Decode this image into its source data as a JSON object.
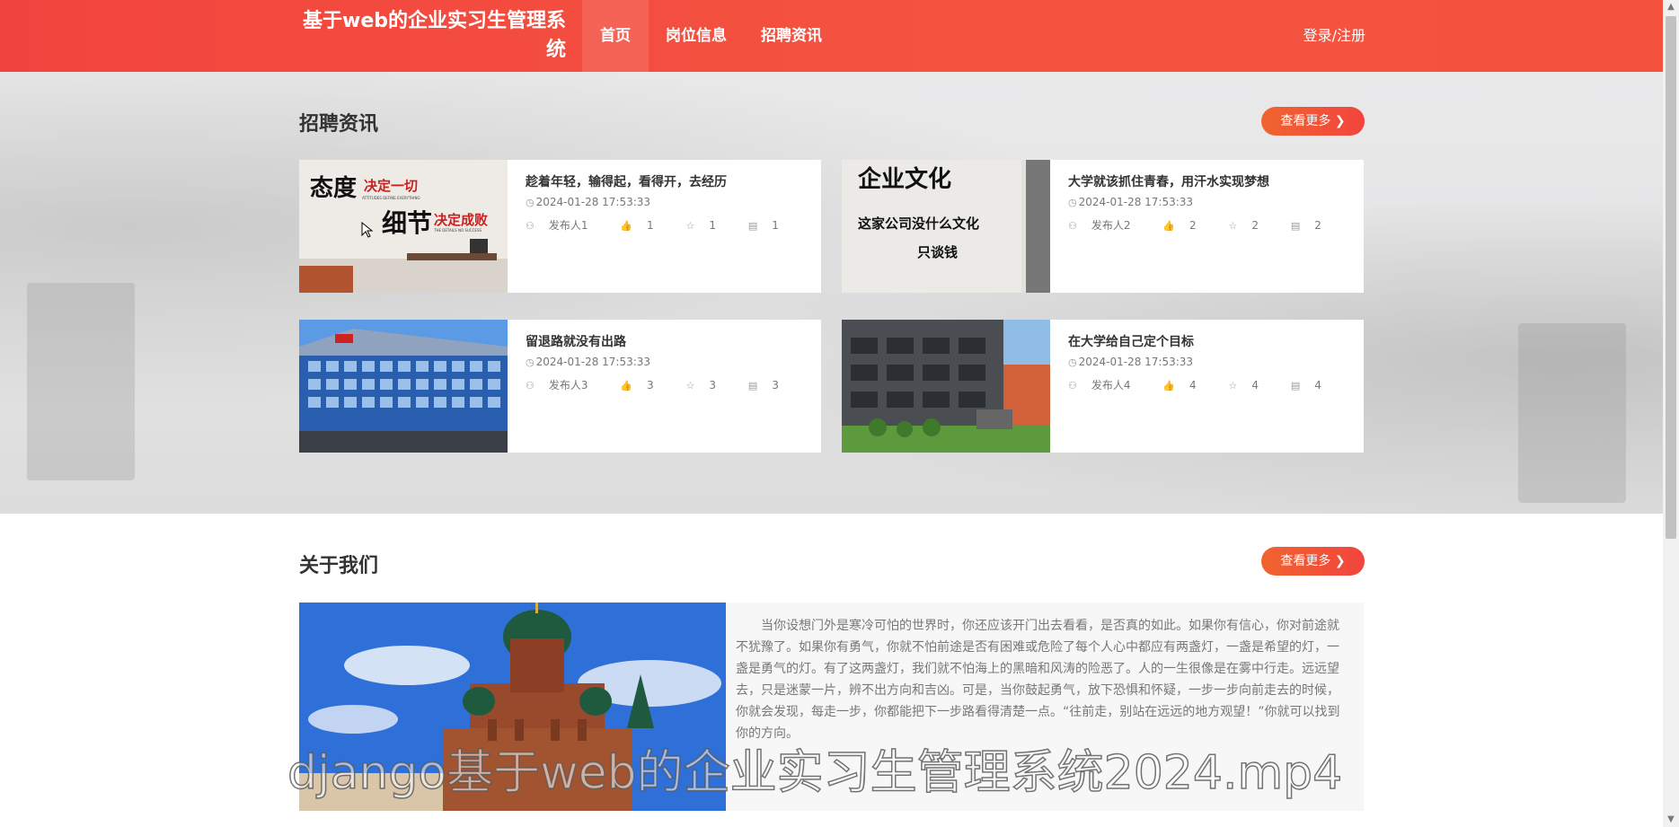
{
  "header": {
    "site_title": "基于web的企业实习生管理系统",
    "nav": [
      "首页",
      "岗位信息",
      "招聘资讯"
    ],
    "login": "登录/注册"
  },
  "news": {
    "title": "招聘资讯",
    "more": "查看更多 ❯",
    "items": [
      {
        "title": "趁着年轻，输得起，看得开，去经历",
        "date": "2024-01-28 17:53:33",
        "author": "发布人1",
        "likes": "1",
        "favs": "1",
        "comments": "1"
      },
      {
        "title": "大学就该抓住青春，用汗水实现梦想",
        "date": "2024-01-28 17:53:33",
        "author": "发布人2",
        "likes": "2",
        "favs": "2",
        "comments": "2"
      },
      {
        "title": "留退路就没有出路",
        "date": "2024-01-28 17:53:33",
        "author": "发布人3",
        "likes": "3",
        "favs": "3",
        "comments": "3"
      },
      {
        "title": "在大学给自己定个目标",
        "date": "2024-01-28 17:53:33",
        "author": "发布人4",
        "likes": "4",
        "favs": "4",
        "comments": "4"
      }
    ],
    "image_text": {
      "sign1_a": "态度",
      "sign1_b": "决定一切",
      "sign1_c": "细节",
      "sign1_d": "决定成败",
      "sign1_e": "ATTITUDES DEFINE EVERYTHING",
      "sign1_f": "THE DETAILS NO SUCCESS",
      "sign2_a": "企业文化",
      "sign2_b": "这家公司没什么文化",
      "sign2_c": "只谈钱"
    }
  },
  "about": {
    "title": "关于我们",
    "more": "查看更多 ❯",
    "text": "当你设想门外是寒冷可怕的世界时，你还应该开门出去看看，是否真的如此。如果你有信心，你对前途就不犹豫了。如果你有勇气，你就不怕前途是否有困难或危险了每个人心中都应有两盏灯，一盏是希望的灯，一盏是勇气的灯。有了这两盏灯，我们就不怕海上的黑暗和风涛的险恶了。人的一生很像是在雾中行走。远远望去，只是迷蒙一片，辨不出方向和吉凶。可是，当你鼓起勇气，放下恐惧和怀疑，一步一步向前走去的时候，你就会发现，每走一步，你都能把下一步路看得清楚一点。“往前走，别站在远远的地方观望！”你就可以找到你的方向。"
  },
  "watermark": "django基于web的企业实习生管理系统2024.mp4",
  "colors": {
    "brand": "#f2443e",
    "accent": "#f0642f"
  }
}
